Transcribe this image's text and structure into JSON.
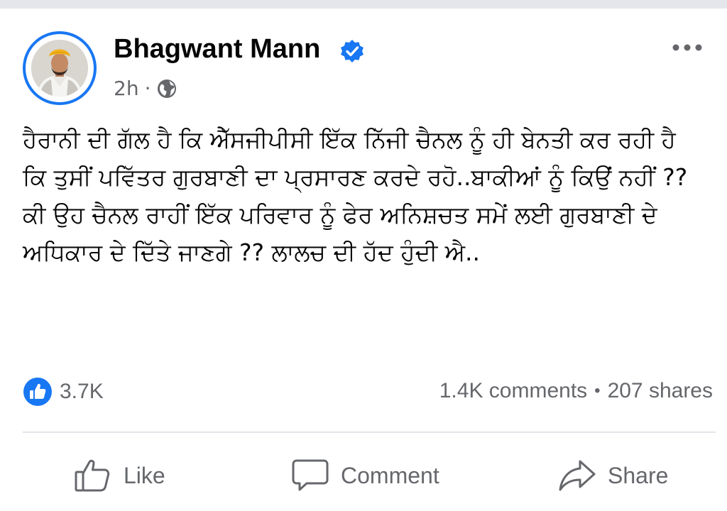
{
  "post": {
    "author": "Bhagwant Mann",
    "verified": true,
    "time": "2h",
    "meta_separator": "·",
    "audience_icon": "globe-icon",
    "body": "ਹੈਰਾਨੀ ਦੀ ਗੱਲ ਹੈ ਕਿ ਐੱਸਜੀਪੀਸੀ ਇੱਕ ਨਿੱਜੀ ਚੈਨਲ ਨੂੰ ਹੀ ਬੇਨਤੀ ਕਰ ਰਹੀ ਹੈ ਕਿ ਤੁਸੀਂ ਪਵਿੱਤਰ ਗੁਰਬਾਣੀ ਦਾ ਪ੍ਰਸਾਰਣ ਕਰਦੇ ਰਹੋ..ਬਾਕੀਆਂ ਨੂੰ ਕਿਉਂ ਨਹੀਂ ?? ਕੀ ਉਹ ਚੈਨਲ ਰਾਹੀਂ ਇੱਕ ਪਰਿਵਾਰ ਨੂੰ ਫੇਰ ਅਨਿਸ਼ਚਤ ਸਮੇਂ ਲਈ ਗੁਰਬਾਣੀ ਦੇ ਅਧਿਕਾਰ ਦੇ ਦਿੱਤੇ ਜਾਣਗੇ ?? ਲਾਲਚ ਦੀ ਹੱਦ ਹੁੰਦੀ ਐ.."
  },
  "engagement": {
    "reaction_count": "3.7K",
    "comments": "1.4K comments",
    "separator": "•",
    "shares": "207 shares"
  },
  "actions": {
    "like_label": "Like",
    "comment_label": "Comment",
    "share_label": "Share"
  },
  "colors": {
    "accent": "#1877f2",
    "secondary_text": "#65676b",
    "divider": "#e4e6eb"
  }
}
